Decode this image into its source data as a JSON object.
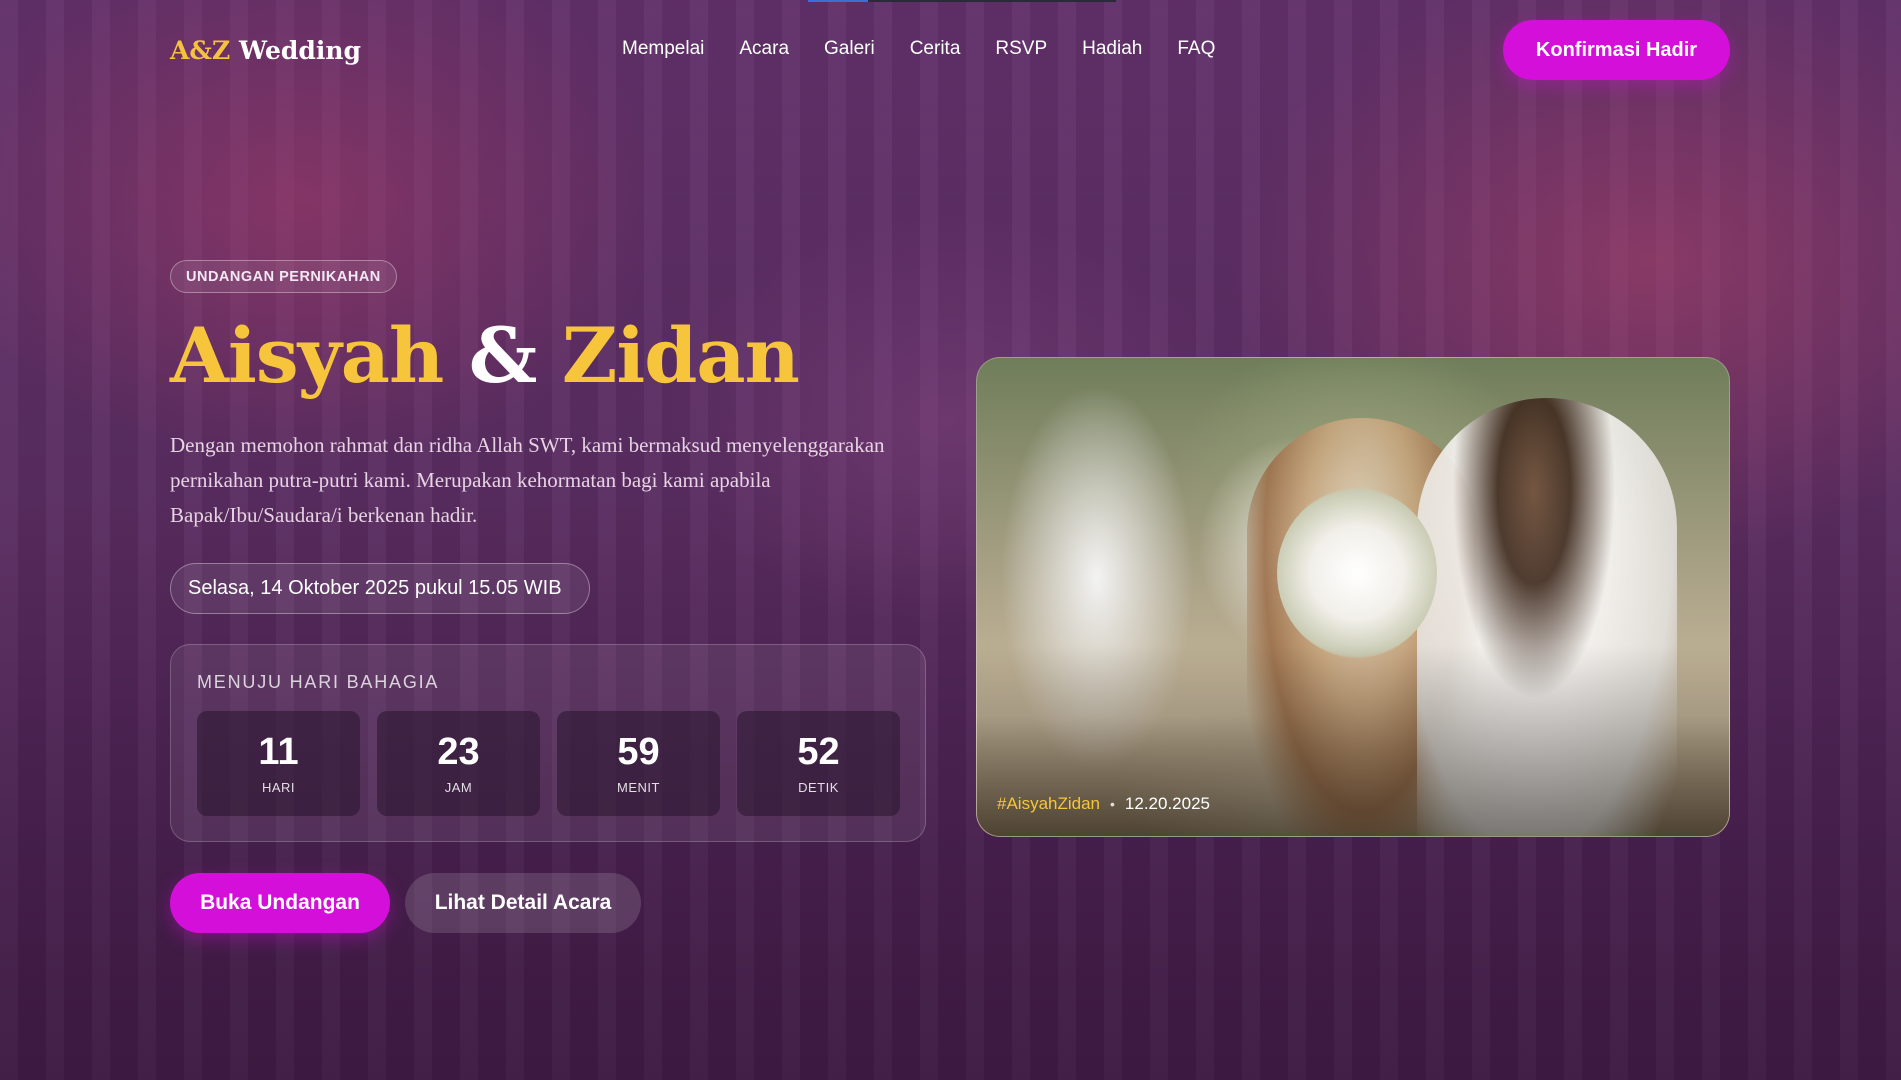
{
  "brand": {
    "monogram": "A&Z",
    "word": "Wedding"
  },
  "nav": [
    "Mempelai",
    "Acara",
    "Galeri",
    "Cerita",
    "RSVP",
    "Hadiah",
    "FAQ"
  ],
  "header_cta": "Konfirmasi Hadir",
  "hero": {
    "eyebrow": "UNDANGAN PERNIKAHAN",
    "name1": "Aisyah",
    "amp": "&",
    "name2": "Zidan",
    "intro": "Dengan memohon rahmat dan ridha Allah SWT, kami bermaksud menyelenggarakan pernikahan putra-putri kami. Merupakan kehormatan bagi kami apabila Bapak/Ibu/Saudara/i berkenan hadir.",
    "datetime": "Selasa, 14 Oktober 2025 pukul 15.05 WIB"
  },
  "countdown": {
    "title": "MENUJU HARI BAHAGIA",
    "units": [
      {
        "value": "11",
        "label": "HARI"
      },
      {
        "value": "23",
        "label": "JAM"
      },
      {
        "value": "59",
        "label": "MENIT"
      },
      {
        "value": "52",
        "label": "DETIK"
      }
    ]
  },
  "actions": {
    "primary": "Buka Undangan",
    "secondary": "Lihat Detail Acara"
  },
  "photo": {
    "hashtag": "#AisyahZidan",
    "date": "12.20.2025",
    "subject_icon": "wedding-couple-photo"
  },
  "colors": {
    "accent": "#d40fd9",
    "gold": "#f7c53b",
    "background": "#5a2f62"
  }
}
